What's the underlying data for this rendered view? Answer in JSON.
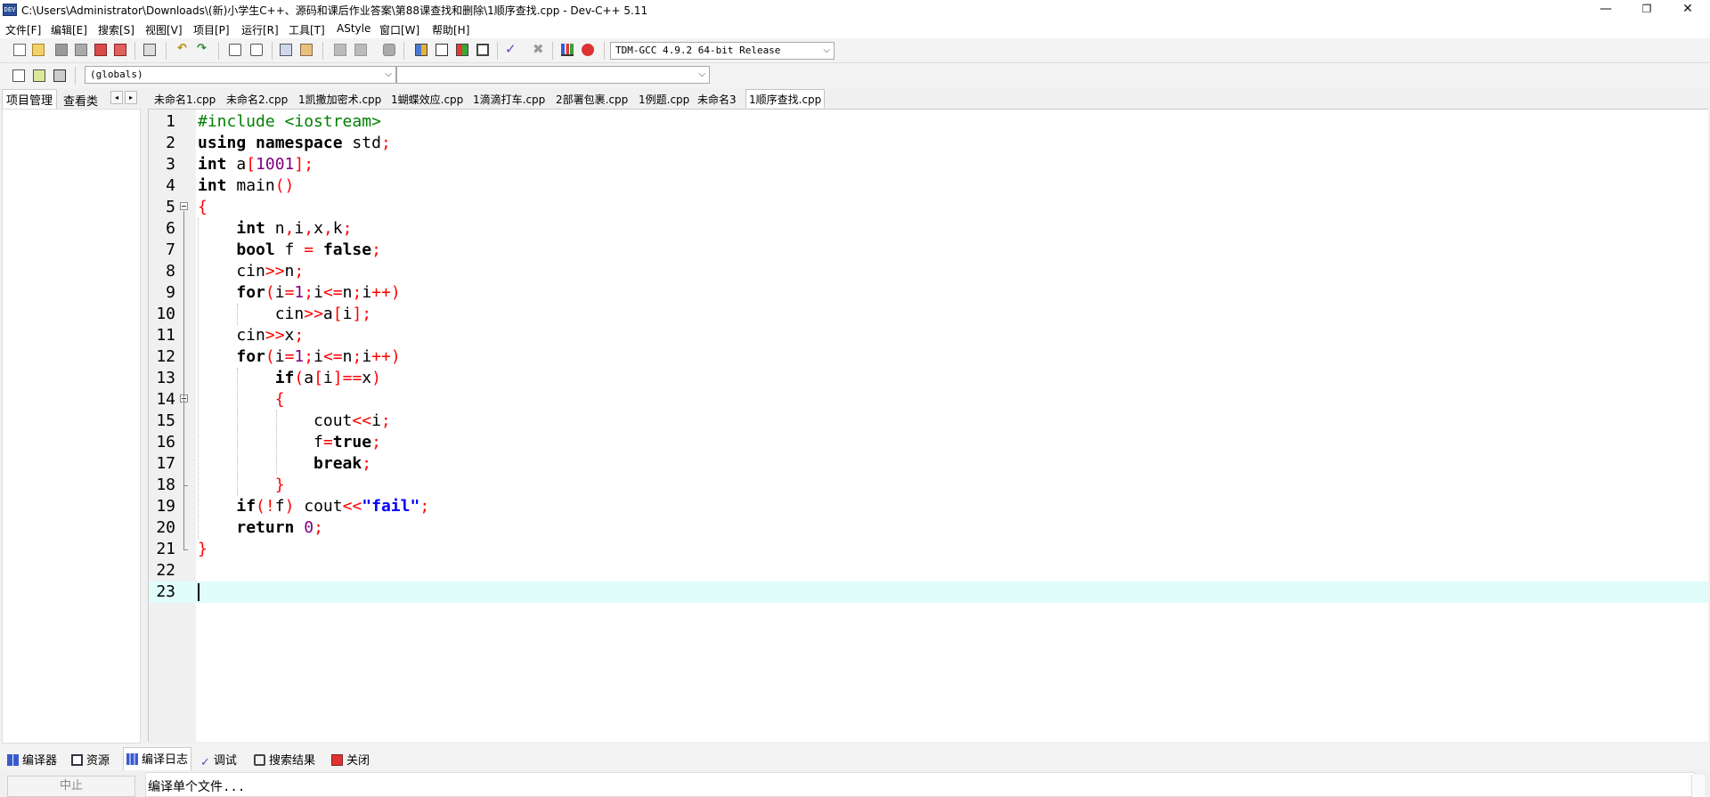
{
  "window": {
    "title": "C:\\Users\\Administrator\\Downloads\\(新)小学生C++、源码和课后作业答案\\第88课查找和删除\\1顺序查找.cpp - Dev-C++ 5.11",
    "app_icon_text": "DEV",
    "minimize": "—",
    "maximize": "❐",
    "close": "✕"
  },
  "menu": [
    "文件[F]",
    "编辑[E]",
    "搜索[S]",
    "视图[V]",
    "项目[P]",
    "运行[R]",
    "工具[T]",
    "AStyle",
    "窗口[W]",
    "帮助[H]"
  ],
  "toolbar": {
    "compiler_select": "TDM-GCC 4.9.2 64-bit Release",
    "scope_select": "(globals)",
    "symbol_select": ""
  },
  "left_panel": {
    "tabs": [
      "项目管理",
      "查看类"
    ],
    "arrow_left": "◂",
    "arrow_right": "▸"
  },
  "editor_tabs": [
    "未命名1.cpp",
    "未命名2.cpp",
    "1凯撒加密术.cpp",
    "1蝴蝶效应.cpp",
    "1滴滴打车.cpp",
    "2部署包裹.cpp",
    "1例题.cpp",
    "未命名3",
    "1顺序查找.cpp"
  ],
  "active_editor_tab": "1顺序查找.cpp",
  "code_lines": [
    "#include <iostream>",
    "using namespace std;",
    "int a[1001];",
    "int main()",
    "{",
    "    int n,i,x,k;",
    "    bool f = false;",
    "    cin>>n;",
    "    for(i=1;i<=n;i++)",
    "        cin>>a[i];",
    "    cin>>x;",
    "    for(i=1;i<=n;i++)",
    "        if(a[i]==x)",
    "        {",
    "            cout<<i;",
    "            f=true;",
    "            break;",
    "        }",
    "    if(!f) cout<<\"fail\";",
    "    return 0;",
    "}",
    "",
    ""
  ],
  "current_line": 23,
  "bottom_tabs": [
    "编译器",
    "资源",
    "编译日志",
    "调试",
    "搜索结果",
    "关闭"
  ],
  "active_bottom_tab": "编译日志",
  "bottom_panel": {
    "stop_button": "中止",
    "log_lines": [
      "编译单个文件...",
      "--------"
    ]
  },
  "colors": {
    "keyword": "#000000",
    "preprocessor": "#008000",
    "number": "#800080",
    "string": "#0000ff",
    "symbol": "#ff0000",
    "current_line_bg": "#e0fcfb"
  }
}
